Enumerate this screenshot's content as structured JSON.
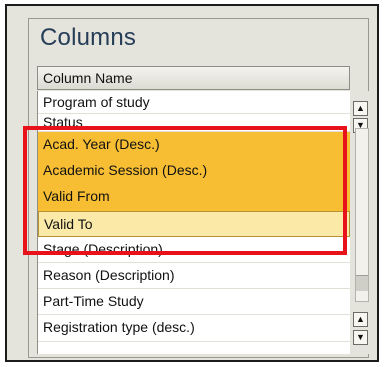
{
  "panel": {
    "title": "Columns",
    "column_header": "Column Name"
  },
  "rows": [
    "Program of study",
    "Status",
    "Acad. Year (Desc.)",
    "Academic Session (Desc.)",
    "Valid From",
    "Valid To",
    "Stage (Description)",
    "Reason (Description)",
    "Part-Time Study",
    "Registration type (desc.)"
  ],
  "scroll": {
    "up_glyph": "▲",
    "down_glyph": "▼"
  },
  "colors": {
    "selection": "#f7be34",
    "lead_selection": "#fbe9a8",
    "highlight_box": "#e8131a"
  }
}
